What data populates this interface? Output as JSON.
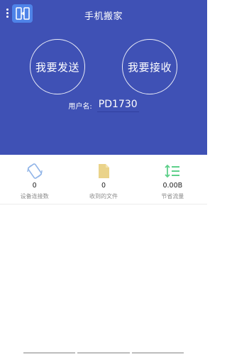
{
  "header": {
    "title": "手机搬家",
    "menu_icon": "more-vertical-icon",
    "logo_icon": "app-logo-icon"
  },
  "actions": {
    "send_label": "我要发送",
    "receive_label": "我要接收"
  },
  "user": {
    "label": "用户名:",
    "name": "PD1730"
  },
  "stats": [
    {
      "icon": "devices-icon",
      "value": "0",
      "label": "设备连接数",
      "color": "#90b4e8"
    },
    {
      "icon": "file-icon",
      "value": "0",
      "label": "收到的文件",
      "color": "#ead38a"
    },
    {
      "icon": "traffic-icon",
      "value": "0.00B",
      "label": "节省流量",
      "color": "#5ed08a"
    }
  ],
  "colors": {
    "primary": "#3f51b5"
  }
}
